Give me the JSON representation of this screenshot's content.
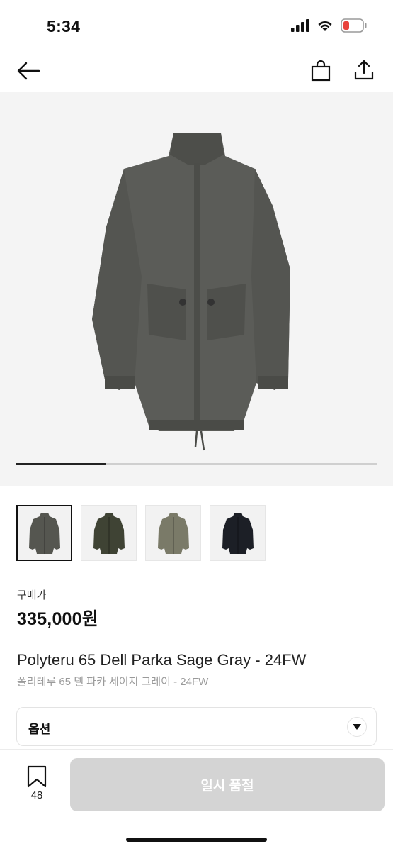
{
  "status_bar": {
    "time": "5:34",
    "icons": [
      "signal-icon",
      "wifi-icon",
      "battery-low-icon"
    ]
  },
  "nav": {
    "back_icon": "back-arrow-icon",
    "bag_icon": "shopping-bag-icon",
    "share_icon": "share-icon"
  },
  "gallery": {
    "image": "sage-gray-parka-photo",
    "progress_fraction": 0.25,
    "thumbnails": [
      {
        "name": "thumbnail-sage-gray",
        "color": "#555650",
        "selected": true
      },
      {
        "name": "thumbnail-olive",
        "color": "#3f4334",
        "selected": false
      },
      {
        "name": "thumbnail-khaki",
        "color": "#7a7a68",
        "selected": false
      },
      {
        "name": "thumbnail-black",
        "color": "#1c1f26",
        "selected": false
      }
    ]
  },
  "product": {
    "price_label": "구매가",
    "price": "335,000원",
    "name_en": "Polyteru 65 Dell Parka Sage Gray - 24FW",
    "name_ko": "폴리테루 65 델 파카 세이지 그레이 - 24FW"
  },
  "option": {
    "label": "옵션",
    "icon": "chevron-down-icon"
  },
  "bottom": {
    "bookmark_icon": "bookmark-icon",
    "bookmark_count": "48",
    "soldout_label": "일시 품절"
  },
  "colors": {
    "button_disabled": "#d4d4d4",
    "hero_background": "#f4f4f4",
    "battery_low": "#e8423b"
  }
}
